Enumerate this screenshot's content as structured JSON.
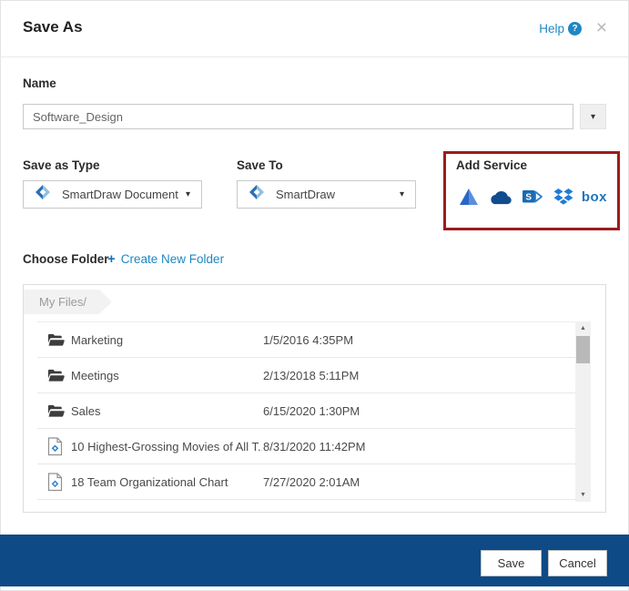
{
  "dialog": {
    "title": "Save As",
    "help_label": "Help"
  },
  "icons": {
    "help_badge": "?",
    "close": "×",
    "caret_down": "▾",
    "scroll_up": "▲",
    "scroll_down": "▼",
    "plus": "+"
  },
  "name_field": {
    "label": "Name",
    "value": "Software_Design"
  },
  "save_as_type": {
    "label": "Save as Type",
    "value": "SmartDraw Document"
  },
  "save_to": {
    "label": "Save To",
    "value": "SmartDraw"
  },
  "add_service": {
    "label": "Add Service",
    "services": [
      "google-drive",
      "onedrive",
      "sharepoint",
      "dropbox",
      "box"
    ],
    "box_label": "box",
    "sharepoint_letter": "S"
  },
  "choose_folder": {
    "label": "Choose Folder",
    "create_link": "Create New Folder"
  },
  "folder_browser": {
    "breadcrumb": "My Files/",
    "rows": [
      {
        "type": "folder",
        "name": "Marketing",
        "date": "1/5/2016 4:35PM"
      },
      {
        "type": "folder",
        "name": "Meetings",
        "date": "2/13/2018 5:11PM"
      },
      {
        "type": "folder",
        "name": "Sales",
        "date": "6/15/2020 1:30PM"
      },
      {
        "type": "document",
        "name": "10 Highest-Grossing Movies of All T...",
        "date": "8/31/2020 11:42PM"
      },
      {
        "type": "document",
        "name": "18 Team Organizational Chart",
        "date": "7/27/2020 2:01AM"
      }
    ]
  },
  "footer": {
    "save_label": "Save",
    "cancel_label": "Cancel"
  },
  "colors": {
    "accent_blue": "#1e87c4",
    "annotation_red": "#9b1c1c",
    "footer_navy": "#0e4a86",
    "logo_blue_dark": "#2b6fb4",
    "logo_blue_light": "#8fbfe3"
  }
}
